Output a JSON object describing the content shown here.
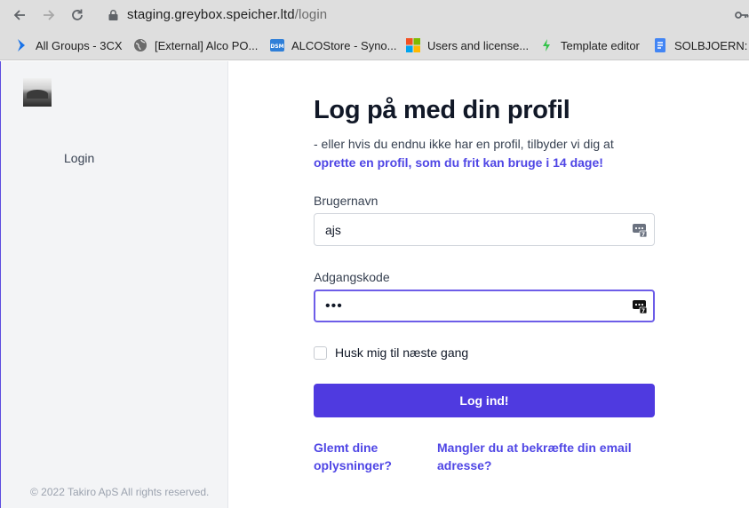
{
  "browser": {
    "url_host": "staging.greybox.speicher.ltd",
    "url_path": "/login",
    "bookmarks": [
      {
        "label": "All Groups - 3CX",
        "icon": "3cx-chevron-icon"
      },
      {
        "label": "[External] Alco PO...",
        "icon": "globe-icon"
      },
      {
        "label": "ALCOStore - Syno...",
        "icon": "dsm-icon"
      },
      {
        "label": "Users and license...",
        "icon": "microsoft-icon"
      },
      {
        "label": "Template editor",
        "icon": "sendgrid-icon"
      },
      {
        "label": "SOLBJOERN: u",
        "icon": "docs-icon"
      }
    ]
  },
  "sidebar": {
    "nav_login": "Login",
    "copyright": "© 2022 Takiro ApS All rights reserved."
  },
  "login": {
    "title": "Log på med din profil",
    "subtitle": "- eller hvis du endnu ikke har en profil, tilbyder vi dig at",
    "signup_link": "oprette en profil, som du frit kan bruge i 14 dage!",
    "username_label": "Brugernavn",
    "username_value": "ajs",
    "password_label": "Adgangskode",
    "password_value": "•••",
    "remember_label": "Husk mig til næste gang",
    "submit_label": "Log ind!",
    "forgot_line1": "Glemt dine",
    "forgot_line2": "oplysninger?",
    "confirm_line1": "Mangler du at bekræfte din email",
    "confirm_line2": "adresse?"
  },
  "colors": {
    "accent": "#4f3ae0",
    "link": "#4f46e5",
    "sidebar_bg": "#f3f4f6"
  }
}
